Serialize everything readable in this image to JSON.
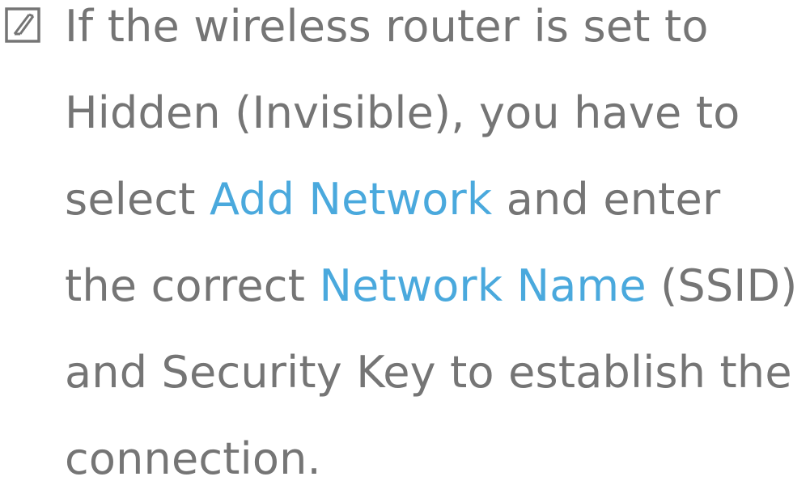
{
  "note": {
    "icon": "note-icon",
    "highlight_color": "#4aa9dd",
    "text_color": "#757575",
    "lines": [
      {
        "text": "If the wireless router is set to"
      },
      {
        "text": "Hidden (Invisible), you have to"
      },
      {
        "before": "select ",
        "highlight": "Add Network",
        "after": " and enter"
      },
      {
        "before": "the correct ",
        "highlight": "Network Name",
        "after": " (SSID)"
      },
      {
        "text": "and Security Key to establish the"
      },
      {
        "text": "connection."
      }
    ]
  }
}
